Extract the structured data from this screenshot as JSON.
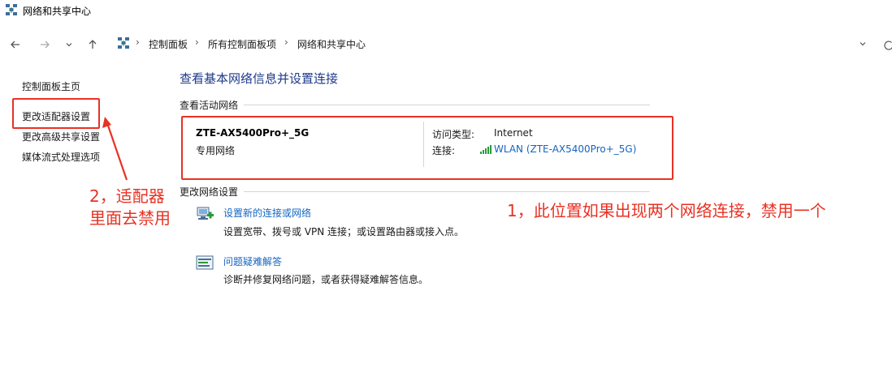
{
  "window": {
    "title": "网络和共享中心"
  },
  "breadcrumb": [
    "控制面板",
    "所有控制面板项",
    "网络和共享中心"
  ],
  "sidebar": {
    "items": [
      {
        "label": "控制面板主页"
      },
      {
        "label": "更改适配器设置"
      },
      {
        "label": "更改高级共享设置"
      },
      {
        "label": "媒体流式处理选项"
      }
    ]
  },
  "main": {
    "title": "查看基本网络信息并设置连接",
    "active_networks_label": "查看活动网络",
    "network": {
      "name": "ZTE-AX5400Pro+_5G",
      "type": "专用网络",
      "access_type_label": "访问类型:",
      "access_type_value": "Internet",
      "connection_label": "连接:",
      "connection_value": "WLAN (ZTE-AX5400Pro+_5G)"
    },
    "change_settings_label": "更改网络设置",
    "tasks": [
      {
        "link": "设置新的连接或网络",
        "desc": "设置宽带、拨号或 VPN 连接；或设置路由器或接入点。",
        "icon": "new-connection-icon"
      },
      {
        "link": "问题疑难解答",
        "desc": "诊断并修复网络问题，或者获得疑难解答信息。",
        "icon": "troubleshoot-icon"
      }
    ]
  },
  "annotations": {
    "note1": "1，此位置如果出现两个网络连接，禁用一个",
    "note2_line1": "2，适配器",
    "note2_line2": "里面去禁用"
  },
  "colors": {
    "annotation": "#e83224",
    "link": "#1565c0",
    "title": "#1e3a8a"
  }
}
